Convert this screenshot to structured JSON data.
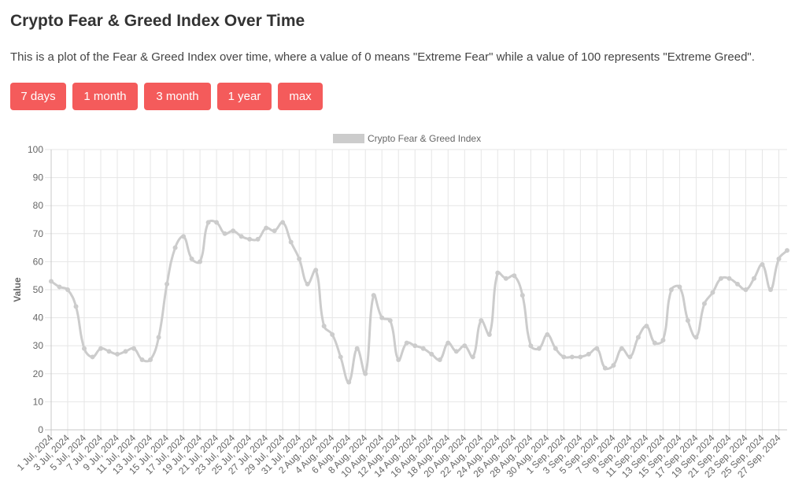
{
  "header": {
    "title": "Crypto Fear & Greed Index Over Time",
    "description": "This is a plot of the Fear & Greed Index over time, where a value of 0 means \"Extreme Fear\" while a value of 100 represents \"Extreme Greed\"."
  },
  "range_buttons": [
    {
      "label": "7 days"
    },
    {
      "label": "1 month"
    },
    {
      "label": "3 month"
    },
    {
      "label": "1 year"
    },
    {
      "label": "max"
    }
  ],
  "colors": {
    "button_bg": "#f45b5b",
    "series_line": "#cccccc"
  },
  "chart_data": {
    "type": "line",
    "title": "",
    "xlabel": "",
    "ylabel": "Value",
    "ylim": [
      0,
      100
    ],
    "yticks": [
      0,
      10,
      20,
      30,
      40,
      50,
      60,
      70,
      80,
      90,
      100
    ],
    "grid": true,
    "legend_position": "top-center",
    "x_tick_every": 2,
    "x": [
      "1 Jul, 2024",
      "2 Jul, 2024",
      "3 Jul, 2024",
      "4 Jul, 2024",
      "5 Jul, 2024",
      "6 Jul, 2024",
      "7 Jul, 2024",
      "8 Jul, 2024",
      "9 Jul, 2024",
      "10 Jul, 2024",
      "11 Jul, 2024",
      "12 Jul, 2024",
      "13 Jul, 2024",
      "14 Jul, 2024",
      "15 Jul, 2024",
      "16 Jul, 2024",
      "17 Jul, 2024",
      "18 Jul, 2024",
      "19 Jul, 2024",
      "20 Jul, 2024",
      "21 Jul, 2024",
      "22 Jul, 2024",
      "23 Jul, 2024",
      "24 Jul, 2024",
      "25 Jul, 2024",
      "26 Jul, 2024",
      "27 Jul, 2024",
      "28 Jul, 2024",
      "29 Jul, 2024",
      "30 Jul, 2024",
      "31 Jul, 2024",
      "1 Aug, 2024",
      "2 Aug, 2024",
      "3 Aug, 2024",
      "4 Aug, 2024",
      "5 Aug, 2024",
      "6 Aug, 2024",
      "7 Aug, 2024",
      "8 Aug, 2024",
      "9 Aug, 2024",
      "10 Aug, 2024",
      "11 Aug, 2024",
      "12 Aug, 2024",
      "13 Aug, 2024",
      "14 Aug, 2024",
      "15 Aug, 2024",
      "16 Aug, 2024",
      "17 Aug, 2024",
      "18 Aug, 2024",
      "19 Aug, 2024",
      "20 Aug, 2024",
      "21 Aug, 2024",
      "22 Aug, 2024",
      "23 Aug, 2024",
      "24 Aug, 2024",
      "25 Aug, 2024",
      "26 Aug, 2024",
      "27 Aug, 2024",
      "28 Aug, 2024",
      "29 Aug, 2024",
      "30 Aug, 2024",
      "31 Aug, 2024",
      "1 Sep, 2024",
      "2 Sep, 2024",
      "3 Sep, 2024",
      "4 Sep, 2024",
      "5 Sep, 2024",
      "6 Sep, 2024",
      "7 Sep, 2024",
      "8 Sep, 2024",
      "9 Sep, 2024",
      "10 Sep, 2024",
      "11 Sep, 2024",
      "12 Sep, 2024",
      "13 Sep, 2024",
      "14 Sep, 2024",
      "15 Sep, 2024",
      "16 Sep, 2024",
      "17 Sep, 2024",
      "18 Sep, 2024",
      "19 Sep, 2024",
      "20 Sep, 2024",
      "21 Sep, 2024",
      "22 Sep, 2024",
      "23 Sep, 2024",
      "24 Sep, 2024",
      "25 Sep, 2024",
      "26 Sep, 2024",
      "27 Sep, 2024",
      "28 Sep, 2024"
    ],
    "series": [
      {
        "name": "Crypto Fear & Greed Index",
        "color": "#cccccc",
        "values": [
          53,
          51,
          50,
          44,
          29,
          26,
          29,
          28,
          27,
          28,
          29,
          25,
          25,
          33,
          52,
          65,
          69,
          61,
          60,
          74,
          74,
          70,
          71,
          69,
          68,
          68,
          72,
          71,
          74,
          67,
          61,
          52,
          57,
          37,
          34,
          26,
          17,
          29,
          20,
          48,
          40,
          39,
          25,
          31,
          30,
          29,
          27,
          25,
          31,
          28,
          30,
          26,
          39,
          34,
          56,
          54,
          55,
          48,
          30,
          29,
          34,
          29,
          26,
          26,
          26,
          27,
          29,
          22,
          23,
          29,
          26,
          33,
          37,
          31,
          32,
          50,
          51,
          39,
          33,
          45,
          49,
          54,
          54,
          52,
          50,
          54,
          59,
          50,
          61,
          64
        ]
      }
    ]
  }
}
